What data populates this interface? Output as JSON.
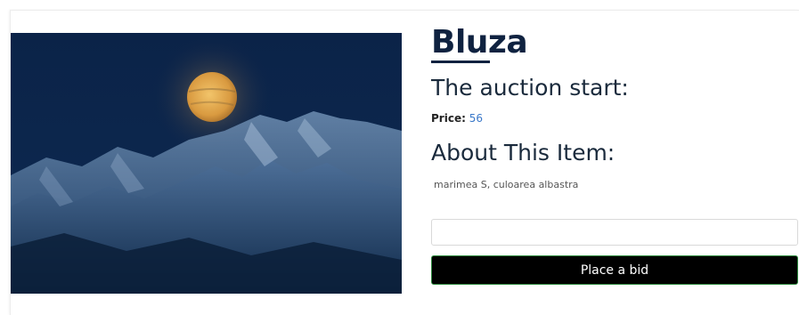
{
  "item": {
    "title": "Bluza",
    "image_icon": "moon-over-mountains-image",
    "auction_heading": "The auction start:",
    "price_label": "Price:",
    "price_value": "56",
    "about_heading": "About This Item:",
    "description": "marimea S, culoarea albastra"
  },
  "bid": {
    "input_value": "",
    "input_placeholder": "",
    "button_label": "Place a bid"
  },
  "colors": {
    "title": "#0f2240",
    "price_value": "#3a78c9",
    "button_bg": "#000000",
    "button_border": "#2c8a3e"
  }
}
